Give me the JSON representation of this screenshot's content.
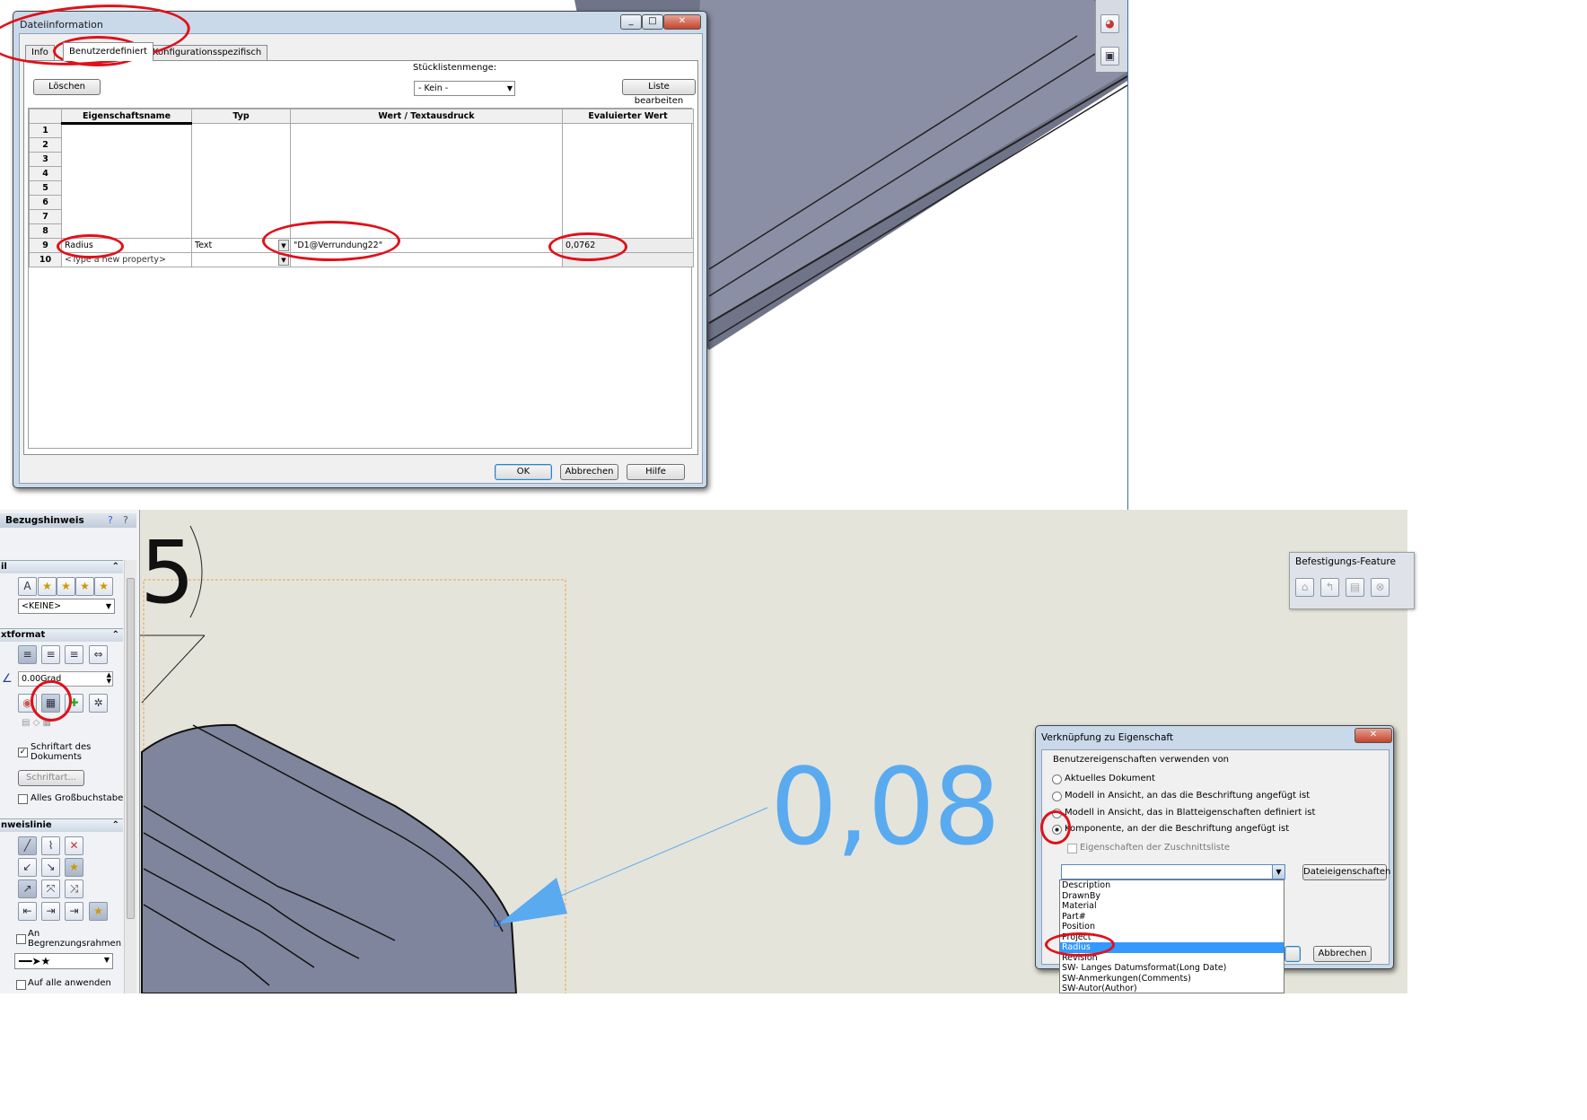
{
  "file_dialog": {
    "title": "Dateiinformation",
    "tabs": [
      "Info",
      "Benutzerdefiniert",
      "Konfigurationsspezifisch"
    ],
    "active_tab": "Benutzerdefiniert",
    "delete_button": "Löschen",
    "bom_qty_label": "Stücklistenmenge:",
    "bom_qty_value": "- Kein -",
    "edit_list_button": "Liste bearbeiten",
    "columns": [
      "Eigenschaftsname",
      "Typ",
      "Wert / Textausdruck",
      "Evaluierter Wert"
    ],
    "rows": [
      {
        "n": "1",
        "name": "",
        "type": "",
        "value": "",
        "eval": ""
      },
      {
        "n": "2",
        "name": "",
        "type": "",
        "value": "",
        "eval": ""
      },
      {
        "n": "3",
        "name": "",
        "type": "",
        "value": "",
        "eval": ""
      },
      {
        "n": "4",
        "name": "",
        "type": "",
        "value": "",
        "eval": ""
      },
      {
        "n": "5",
        "name": "",
        "type": "",
        "value": "",
        "eval": ""
      },
      {
        "n": "6",
        "name": "",
        "type": "",
        "value": "",
        "eval": ""
      },
      {
        "n": "7",
        "name": "",
        "type": "",
        "value": "",
        "eval": ""
      },
      {
        "n": "8",
        "name": "",
        "type": "",
        "value": "",
        "eval": ""
      },
      {
        "n": "9",
        "name": "Radius",
        "type": "Text",
        "value": "\"D1@Verrundung22\"",
        "eval": "0,0762"
      },
      {
        "n": "10",
        "name": "<Type a new property>",
        "type": "",
        "value": "",
        "eval": ""
      }
    ],
    "ok": "OK",
    "cancel": "Abbrechen",
    "help": "Hilfe"
  },
  "property_manager": {
    "title": "Bezugshinweis",
    "style_section": "il",
    "style_value": "<KEINE>",
    "text_format_section": "xtformat",
    "angle_value": "0.00Grad",
    "doc_font_label": "Schriftart des Dokuments",
    "font_button": "Schriftart...",
    "all_caps_label": "Alles Großbuchstaben",
    "leader_section": "nweislinie",
    "border_label": "An Begrenzungsrahmen",
    "apply_all_label": "Auf alle anwenden"
  },
  "canvas": {
    "note_value": "0,08",
    "dimension_digit": "5"
  },
  "fastening_toolbar": {
    "title": "Befestigungs-Feature"
  },
  "link_dialog": {
    "title": "Verknüpfung zu Eigenschaft",
    "group_label": "Benutzereigenschaften verwenden von",
    "options": [
      "Aktuelles Dokument",
      "Modell in Ansicht, an das die Beschriftung angefügt ist",
      "Modell in Ansicht, das in Blatteigenschaften definiert ist",
      "Komponente, an der die Beschriftung angefügt ist"
    ],
    "selected_option": 3,
    "cutlist_label": "Eigenschaften der Zuschnittsliste",
    "file_props_button": "Dateieigenschaften",
    "cancel": "Abbrechen",
    "list_items": [
      "Description",
      "DrawnBy",
      "Material",
      "Part#",
      "Position",
      "Project",
      "Radius",
      "Revision",
      "SW- Langes Datumsformat(Long Date)",
      "SW-Anmerkungen(Comments)",
      "SW-Autor(Author)"
    ],
    "selected_item": "Radius"
  },
  "colors": {
    "accent": "#3399ff",
    "annotation_blue": "#5aaaf0",
    "highlight_red": "#e0101a",
    "model_face": "#7f859c"
  }
}
